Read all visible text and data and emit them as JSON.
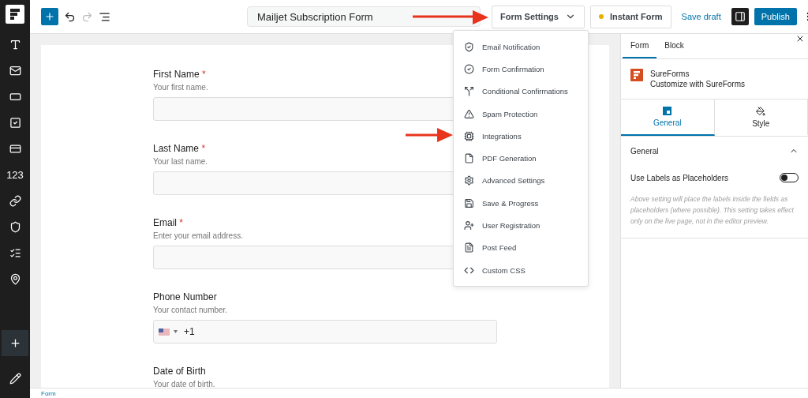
{
  "sidebar": {
    "items": [
      {
        "kind": "icon",
        "selected": false
      },
      {
        "kind": "icon",
        "selected": false
      },
      {
        "kind": "icon",
        "selected": false
      },
      {
        "kind": "icon",
        "selected": false
      },
      {
        "kind": "icon",
        "selected": false
      },
      {
        "kind": "text",
        "label": "123",
        "selected": false
      },
      {
        "kind": "icon",
        "selected": false
      },
      {
        "kind": "icon",
        "selected": false
      },
      {
        "kind": "icon",
        "selected": false
      },
      {
        "kind": "icon",
        "selected": false
      }
    ],
    "bottom_items": [
      {
        "kind": "icon",
        "selected": true
      },
      {
        "kind": "icon",
        "selected": false
      }
    ]
  },
  "toolbar": {
    "title_field": {
      "value": "Mailjet Subscription Form"
    },
    "form_settings": {
      "label": "Form Settings",
      "expanded": true
    },
    "instant_form": {
      "label": "Instant Form"
    },
    "save_draft": "Save draft",
    "sidebar_toggle": {
      "pressed": true
    },
    "publish": "Publish"
  },
  "form_fields": [
    {
      "kind": "text",
      "label": "First Name",
      "required_mark": "*",
      "hint": "Your first name."
    },
    {
      "kind": "text",
      "label": "Last Name",
      "required_mark": "*",
      "hint": "Your last name."
    },
    {
      "kind": "text",
      "label": "Email",
      "required_mark": "*",
      "hint": "Enter your email address."
    },
    {
      "kind": "phone",
      "label": "Phone Number",
      "hint": "Your contact number.",
      "value": "+1"
    },
    {
      "kind": "heading",
      "label": "Date of Birth",
      "hint": "Your date of birth."
    }
  ],
  "settings_menu": [
    {
      "label": "Email Notification"
    },
    {
      "label": "Form Confirmation"
    },
    {
      "label": "Conditional Confirmations"
    },
    {
      "label": "Spam Protection"
    },
    {
      "label": "Integrations"
    },
    {
      "label": "PDF Generation"
    },
    {
      "label": "Advanced Settings"
    },
    {
      "label": "Save & Progress"
    },
    {
      "label": "User Registration"
    },
    {
      "label": "Post Feed"
    },
    {
      "label": "Custom CSS"
    }
  ],
  "panel": {
    "tabs": [
      {
        "label": "Form",
        "selected": true
      },
      {
        "label": "Block",
        "selected": false
      }
    ],
    "plugin": {
      "name": "SureForms",
      "subtitle": "Customize with SureForms"
    },
    "subtabs": [
      {
        "label": "General",
        "selected": true
      },
      {
        "label": "Style",
        "selected": false
      }
    ],
    "section": {
      "title": "General",
      "expanded": true,
      "toggle_label": "Use Labels as Placeholders",
      "toggle_on": false,
      "help": "Above setting will place the labels inside the fields as placeholders (where possible). This setting takes effect only on the live page, not in the editor preview."
    }
  },
  "breadcrumb": "Form"
}
